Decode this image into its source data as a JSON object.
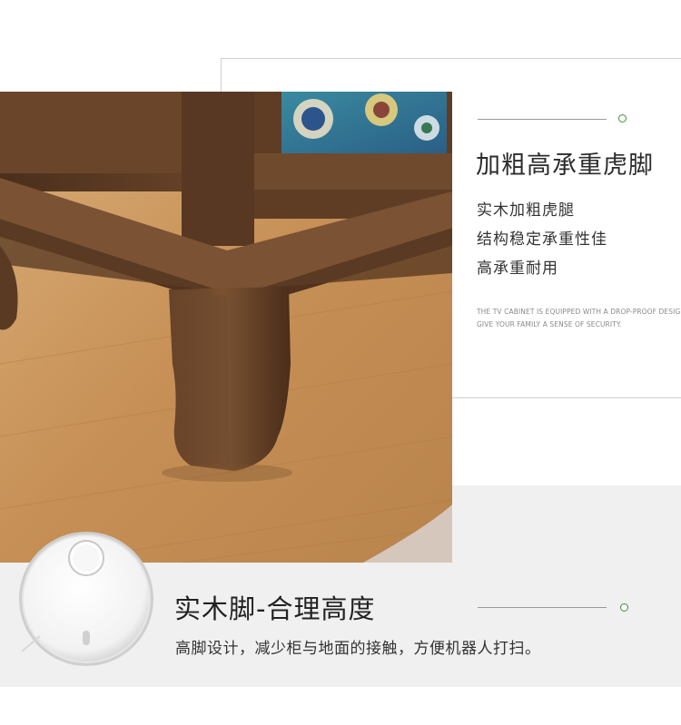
{
  "top_section": {
    "title": "加粗高承重虎脚",
    "features": [
      "实木加粗虎腿",
      "结构稳定承重性佳",
      "高承重耐用"
    ],
    "english_lines": [
      "THE TV CABINET IS EQUIPPED WITH A DROP-PROOF DESIGN",
      "GIVE YOUR FAMILY A SENSE OF SECURITY."
    ]
  },
  "bottom_section": {
    "title": "实木脚-合理高度",
    "description": "高脚设计，减少柜与地面的接触，方便机器人打扫。"
  },
  "colors": {
    "accent_green": "#3f8f3a",
    "band_grey": "#f0f0f0",
    "wood_dark": "#5a3a22",
    "floor_wood": "#c99a63"
  },
  "icons": {
    "decor": "circle-dot-icon",
    "robot": "robot-vacuum-icon"
  }
}
